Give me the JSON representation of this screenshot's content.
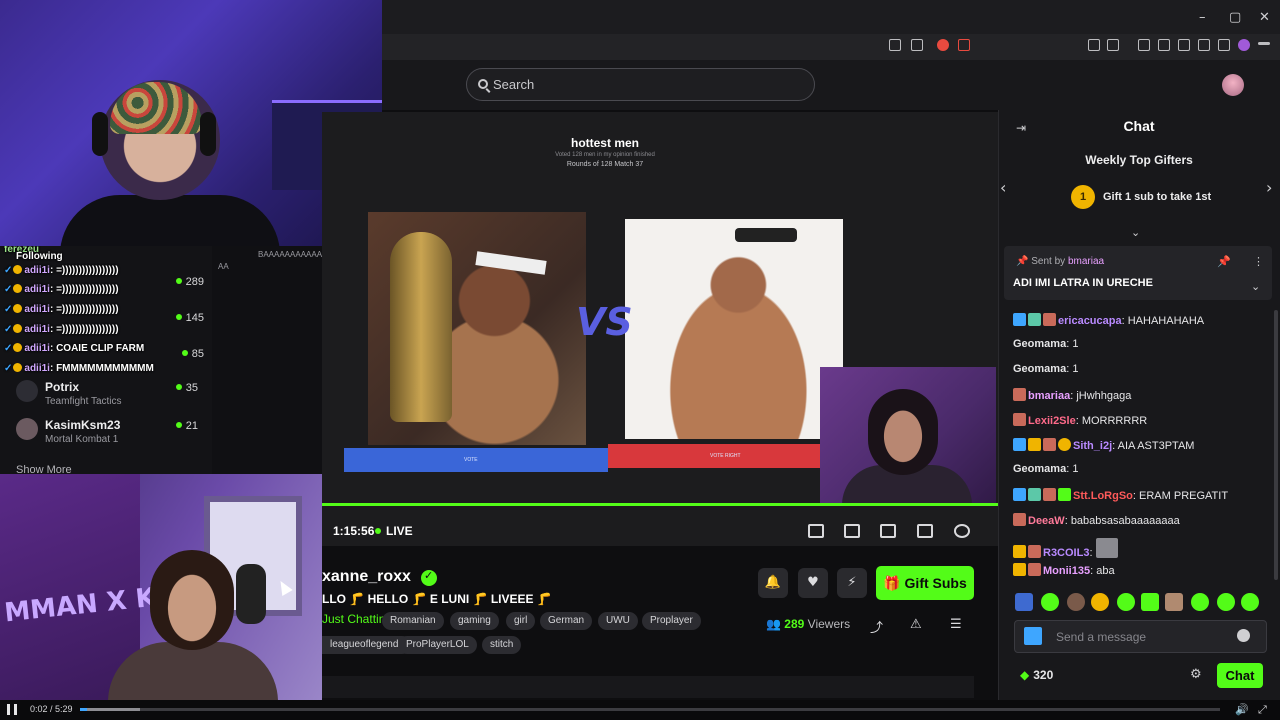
{
  "browser": {
    "search_placeholder": "Search"
  },
  "video": {
    "title": "hottest men",
    "subtitle": "Voted 128 men in my opinion finished",
    "round_info": "Rounds of 128 Match 37",
    "vs_text": "VS",
    "left_vote_label": "VOTE",
    "right_vote_label": "VOTE RIGHT",
    "elapsed": "1:15:56",
    "live_label": "LIVE"
  },
  "sidebar": {
    "following_label": "Following",
    "top_name": "ferezeu",
    "channels": [
      {
        "name": "Potrix",
        "category": "Teamfight Tactics",
        "viewers": "35"
      },
      {
        "name": "KasimKsm23",
        "category": "Mortal Kombat 1",
        "viewers": "21"
      }
    ],
    "overlay_counts": [
      "289",
      "145",
      "85"
    ],
    "show_more": "Show More",
    "chatlog_line": "BAAAAAAAAAAAAAAAA",
    "chatlog_line2": "AA"
  },
  "overlay_chat": [
    {
      "user": "adii1i",
      "text": "=)))))))))))))))))"
    },
    {
      "user": "adii1i",
      "text": "=)))))))))))))))))"
    },
    {
      "user": "adii1i",
      "text": "=)))))))))))))))))"
    },
    {
      "user": "adii1i",
      "text": "=)))))))))))))))))"
    },
    {
      "user": "adii1i",
      "text": "COAIE CLIP FARM"
    },
    {
      "user": "adii1i",
      "text": "FMMMMMMMMMMM"
    }
  ],
  "streamer": {
    "name": "xanne_roxx",
    "title": "LLO 🦵 HELLO 🦵 E LUNI 🦵 LIVEEE 🦵",
    "category": "Just Chatting",
    "tags": [
      "Romanian",
      "gaming",
      "girl",
      "German",
      "UWU",
      "Proplayer",
      "leagueoflegends",
      "ProPlayerLOL",
      "stitch"
    ],
    "viewers_count": "289",
    "viewers_label": "Viewers",
    "gift_button": "Gift Subs"
  },
  "chat": {
    "header": "Chat",
    "gifters_title": "Weekly Top Gifters",
    "gift_rank": "1",
    "gift_cta": "Gift 1 sub to take 1st",
    "pinned_sent_by_label": "Sent by",
    "pinned_user": "bmariaa",
    "pinned_message": "ADI IMI LATRA IN URECHE",
    "messages": [
      {
        "user": "ericacucapa",
        "text": "HAHAHAHAHA",
        "color": "#b98aff"
      },
      {
        "user": "Geomama",
        "text": "1",
        "color": "#e6e6e8"
      },
      {
        "user": "Geomama",
        "text": "1",
        "color": "#e6e6e8"
      },
      {
        "user": "bmariaa",
        "text": "jHwhhgaga",
        "color": "#e8a0ff"
      },
      {
        "user": "Lexii2Sle",
        "text": "MORRRRRR",
        "color": "#ff6a8a"
      },
      {
        "user": "Sith_i2j",
        "text": "AIA AST3PTAM",
        "color": "#b98aff"
      },
      {
        "user": "Geomama",
        "text": "1",
        "color": "#e6e6e8"
      },
      {
        "user": "Stt.LoRgSo",
        "text": "ERAM PREGATIT",
        "color": "#ff5a5a"
      },
      {
        "user": "DeeaW",
        "text": "bababsasabaaaaaaaa",
        "color": "#ff7a9a"
      },
      {
        "user": "R3COIL3",
        "text": "",
        "color": "#b98aff"
      },
      {
        "user": "Monii135",
        "text": "aba",
        "color": "#e8a0ff"
      }
    ],
    "input_placeholder": "Send a message",
    "points": "320",
    "chat_button": "Chat"
  },
  "player": {
    "time": "0:02 / 5:29",
    "progress_fraction": 0.006
  },
  "cam_overlay_text": "MMAN X KICK",
  "colors": {
    "kick_green": "#53fc18",
    "blue_vote": "#3a66d8",
    "red_vote": "#d8383c"
  }
}
